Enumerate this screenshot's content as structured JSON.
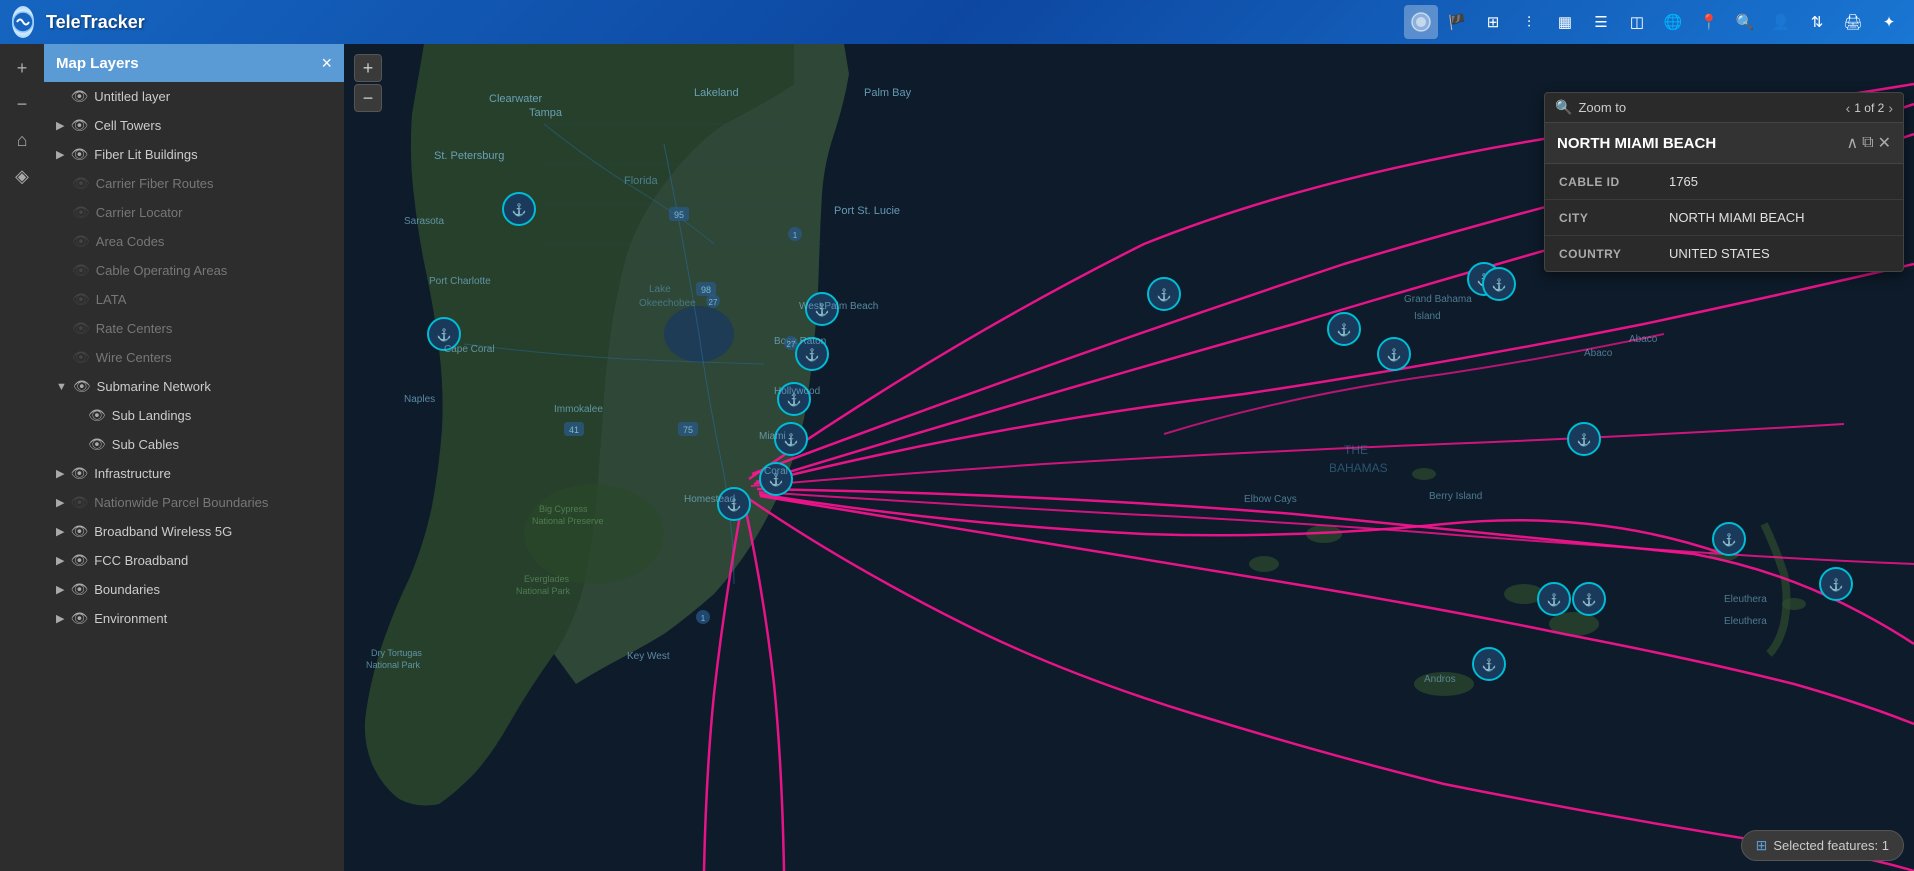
{
  "app": {
    "name": "TeleTracker"
  },
  "toolbar": {
    "tools": [
      {
        "name": "layers-icon",
        "icon": "⊞",
        "label": "Layers"
      },
      {
        "name": "filter-icon",
        "icon": "⚑",
        "label": "Filter"
      },
      {
        "name": "table-icon",
        "icon": "▦",
        "label": "Table"
      },
      {
        "name": "list-icon",
        "icon": "☰",
        "label": "List"
      },
      {
        "name": "chart-icon",
        "icon": "◫",
        "label": "Chart"
      },
      {
        "name": "globe-icon",
        "icon": "🌐",
        "label": "Globe"
      },
      {
        "name": "location-icon",
        "icon": "📍",
        "label": "Location"
      },
      {
        "name": "search-icon",
        "icon": "🔍",
        "label": "Search"
      },
      {
        "name": "user-icon",
        "icon": "👤",
        "label": "User"
      },
      {
        "name": "print-icon",
        "icon": "🖨",
        "label": "Print"
      },
      {
        "name": "star-icon",
        "icon": "★",
        "label": "Star"
      }
    ]
  },
  "left_panel": {
    "buttons": [
      {
        "name": "add-btn",
        "icon": "+",
        "label": "Add"
      },
      {
        "name": "minus-btn",
        "icon": "−",
        "label": "Minus"
      },
      {
        "name": "home-btn",
        "icon": "⌂",
        "label": "Home"
      },
      {
        "name": "bookmark-btn",
        "icon": "◈",
        "label": "Bookmark"
      }
    ]
  },
  "layers_panel": {
    "title": "Map Layers",
    "close_label": "×",
    "layers": [
      {
        "id": "untitled",
        "label": "Untitled layer",
        "visible": true,
        "expandable": false,
        "indent": 0
      },
      {
        "id": "cell-towers",
        "label": "Cell Towers",
        "visible": true,
        "expandable": true,
        "indent": 0
      },
      {
        "id": "fiber-lit",
        "label": "Fiber Lit Buildings",
        "visible": true,
        "expandable": true,
        "indent": 0
      },
      {
        "id": "carrier-fiber",
        "label": "Carrier Fiber Routes",
        "visible": false,
        "expandable": false,
        "indent": 1,
        "dimmed": true
      },
      {
        "id": "carrier-locator",
        "label": "Carrier Locator",
        "visible": false,
        "expandable": false,
        "indent": 1,
        "dimmed": true
      },
      {
        "id": "area-codes",
        "label": "Area Codes",
        "visible": false,
        "expandable": false,
        "indent": 1,
        "dimmed": true
      },
      {
        "id": "cable-op",
        "label": "Cable Operating Areas",
        "visible": false,
        "expandable": false,
        "indent": 1,
        "dimmed": true
      },
      {
        "id": "lata",
        "label": "LATA",
        "visible": false,
        "expandable": false,
        "indent": 1,
        "dimmed": true
      },
      {
        "id": "rate-centers",
        "label": "Rate Centers",
        "visible": false,
        "expandable": false,
        "indent": 1,
        "dimmed": true
      },
      {
        "id": "wire-centers",
        "label": "Wire Centers",
        "visible": false,
        "expandable": false,
        "indent": 1,
        "dimmed": true
      },
      {
        "id": "submarine",
        "label": "Submarine Network",
        "visible": true,
        "expandable": true,
        "indent": 0,
        "expanded": true
      },
      {
        "id": "sub-landings",
        "label": "Sub Landings",
        "visible": true,
        "expandable": false,
        "indent": 2
      },
      {
        "id": "sub-cables",
        "label": "Sub Cables",
        "visible": true,
        "expandable": false,
        "indent": 2
      },
      {
        "id": "infrastructure",
        "label": "Infrastructure",
        "visible": true,
        "expandable": true,
        "indent": 0
      },
      {
        "id": "nationwide-parcel",
        "label": "Nationwide Parcel Boundaries",
        "visible": false,
        "expandable": true,
        "indent": 0,
        "dimmed": true
      },
      {
        "id": "broadband-wireless",
        "label": "Broadband Wireless 5G",
        "visible": true,
        "expandable": true,
        "indent": 0
      },
      {
        "id": "fcc-broadband",
        "label": "FCC Broadband",
        "visible": true,
        "expandable": true,
        "indent": 0
      },
      {
        "id": "boundaries",
        "label": "Boundaries",
        "visible": true,
        "expandable": true,
        "indent": 0
      },
      {
        "id": "environment",
        "label": "Environment",
        "visible": true,
        "expandable": true,
        "indent": 0
      }
    ]
  },
  "popup": {
    "zoom_label": "Zoom to",
    "nav_text": "1 of 2",
    "title": "NORTH MIAMI BEACH",
    "fields": [
      {
        "key": "CABLE ID",
        "value": "1765"
      },
      {
        "key": "CITY",
        "value": "NORTH MIAMI BEACH"
      },
      {
        "key": "COUNTRY",
        "value": "UNITED STATES"
      }
    ]
  },
  "selected_bar": {
    "label": "Selected features: 1"
  },
  "zoom_controls": {
    "plus": "+",
    "minus": "−"
  }
}
